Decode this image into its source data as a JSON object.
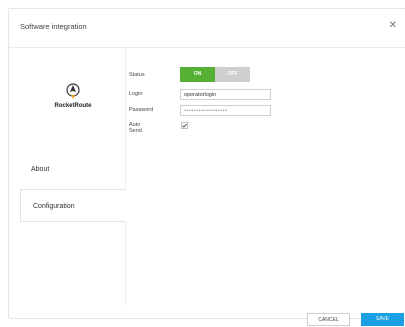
{
  "dialog": {
    "title": "Software integration",
    "close_icon": "close-icon"
  },
  "brand": {
    "name": "RocketRoute",
    "accent": "#f0a11b"
  },
  "nav": [
    {
      "label": "About",
      "selected": false
    },
    {
      "label": "Configuration",
      "selected": true
    }
  ],
  "form": {
    "status_label": "Status",
    "status_on": "ON",
    "status_off": "OFF",
    "status_value": "ON",
    "login_label": "Login",
    "login_value": "operatorlogin",
    "password_label": "Password",
    "password_value": "••••••••••••••••••",
    "auto_send_label": "Auto Send",
    "auto_send_checked": true
  },
  "footer": {
    "cancel": "CANCEL",
    "save": "SAVE"
  },
  "colors": {
    "toggle_on": "#55b033",
    "toggle_off": "#cfcfcf",
    "primary": "#1aa0e2"
  }
}
